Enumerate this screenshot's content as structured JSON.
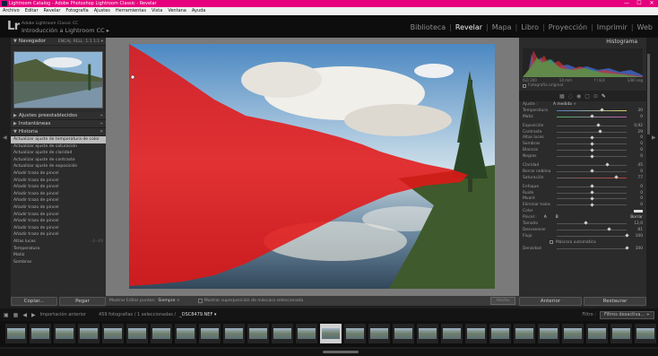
{
  "window": {
    "title": "Lightroom Catalog - Adobe Photoshop Lightroom Classic - Revelar",
    "controls": [
      "—",
      "☐",
      "✕"
    ]
  },
  "menu": [
    "Archivo",
    "Editar",
    "Revelar",
    "Fotografía",
    "Ajustes",
    "Herramientas",
    "Vista",
    "Ventana",
    "Ayuda"
  ],
  "identity": {
    "logo": "Lr",
    "top_line": "Adobe Lightroom Classic CC",
    "catalog_name": "Introducción a Lightroom CC  ▸",
    "modules": [
      "Biblioteca",
      "Revelar",
      "Mapa",
      "Libro",
      "Proyección",
      "Imprimir",
      "Web"
    ],
    "active_module": "Revelar"
  },
  "left_panel": {
    "navigator": {
      "label": "Navegador",
      "zoom_options": "ENCAJ.  RELL.  1:1  1:1 ▾"
    },
    "presets_label": "Ajustes preestablecidos",
    "snapshots_label": "Instantáneas",
    "history_label": "Historia",
    "history": [
      {
        "label": "Actualizar ajuste de temperatura de color",
        "values": "",
        "selected": true
      },
      {
        "label": "Actualizar ajuste de saturación",
        "values": ""
      },
      {
        "label": "Actualizar ajuste de claridad",
        "values": ""
      },
      {
        "label": "Actualizar ajuste de contraste",
        "values": ""
      },
      {
        "label": "Actualizar ajuste de exposición",
        "values": ""
      },
      {
        "label": "Añadir trazo de pincel",
        "values": ""
      },
      {
        "label": "Añadir trazo de pincel",
        "values": ""
      },
      {
        "label": "Añadir trazo de pincel",
        "values": ""
      },
      {
        "label": "Añadir trazo de pincel",
        "values": ""
      },
      {
        "label": "Añadir trazo de pincel",
        "values": ""
      },
      {
        "label": "Añadir trazo de pincel",
        "values": ""
      },
      {
        "label": "Añadir trazo de pincel",
        "values": ""
      },
      {
        "label": "Añadir trazo de pincel",
        "values": ""
      },
      {
        "label": "Añadir trazo de pincel",
        "values": ""
      },
      {
        "label": "Añadir trazo de pincel",
        "values": ""
      },
      {
        "label": "Altas luces",
        "values": "-3  -43"
      },
      {
        "label": "Temperatura",
        "values": ""
      },
      {
        "label": "Matiz",
        "values": ""
      },
      {
        "label": "Sombras",
        "values": ""
      }
    ],
    "copy_button": "Copiar...",
    "paste_button": "Pegar"
  },
  "toolbar": {
    "show_pins_label": "Mostrar Editar puntos:",
    "show_pins_value": "Siempre ÷",
    "overlay_label": "Mostrar superposición de máscara seleccionada",
    "done_button": "Hecho"
  },
  "right_panel": {
    "histogram_label": "Histograma",
    "hist_info": [
      "ISO 200",
      "14 mm",
      "f / 8,0",
      "1/80 seg"
    ],
    "original_photo": "Fotografía original",
    "tools": [
      "▦",
      "◌",
      "◉",
      "▢",
      "⊙",
      "✎"
    ],
    "mask_label": "Ajuste :",
    "mask_value": "A medida ÷",
    "sliders_wb": [
      {
        "label": "Temperatura",
        "value": "30",
        "pos": 0.65,
        "track": "temp"
      },
      {
        "label": "Matiz",
        "value": "0",
        "pos": 0.5,
        "track": "tint"
      }
    ],
    "sliders_tone": [
      {
        "label": "Exposición",
        "value": "0,92",
        "pos": 0.6
      },
      {
        "label": "Contraste",
        "value": "29",
        "pos": 0.62
      },
      {
        "label": "Altas luces",
        "value": "0",
        "pos": 0.5
      },
      {
        "label": "Sombras",
        "value": "0",
        "pos": 0.5
      },
      {
        "label": "Blancos",
        "value": "0",
        "pos": 0.5
      },
      {
        "label": "Negros",
        "value": "0",
        "pos": 0.5
      }
    ],
    "sliders_presence": [
      {
        "label": "Claridad",
        "value": "45",
        "pos": 0.72
      },
      {
        "label": "Borrar neblina",
        "value": "0",
        "pos": 0.5
      },
      {
        "label": "Saturación",
        "value": "77",
        "pos": 0.85,
        "track": "sat"
      }
    ],
    "sliders_detail": [
      {
        "label": "Enfoque",
        "value": "0",
        "pos": 0.5
      },
      {
        "label": "Ruido",
        "value": "0",
        "pos": 0.5
      },
      {
        "label": "Muaré",
        "value": "0",
        "pos": 0.5
      },
      {
        "label": "Eliminar halos",
        "value": "0",
        "pos": 0.5
      }
    ],
    "color_label": "Color",
    "brush": {
      "label": "Pincel :",
      "a": "A",
      "b": "B",
      "erase": "Borrar"
    },
    "sliders_brush": [
      {
        "label": "Tamaño",
        "value": "12,0",
        "pos": 0.42
      },
      {
        "label": "Desvanecer",
        "value": "81",
        "pos": 0.75
      },
      {
        "label": "Flujo",
        "value": "100",
        "pos": 1.0
      }
    ],
    "auto_mask": "Máscara automática",
    "density": {
      "label": "Densidad",
      "value": "100",
      "pos": 1.0
    },
    "prev_button": "Anterior",
    "reset_button": "Restaurar"
  },
  "filmstrip_bar": {
    "import_label": "Importación anterior",
    "count_label": "459 fotografías / 1 seleccionadas /",
    "file_name": "_DSC8479.NEF ▾",
    "filter_label": "Filtro :",
    "filter_value": "Filtros desactiva... ÷"
  },
  "filmstrip": {
    "thumb_count": 27,
    "selected_index": 13
  }
}
